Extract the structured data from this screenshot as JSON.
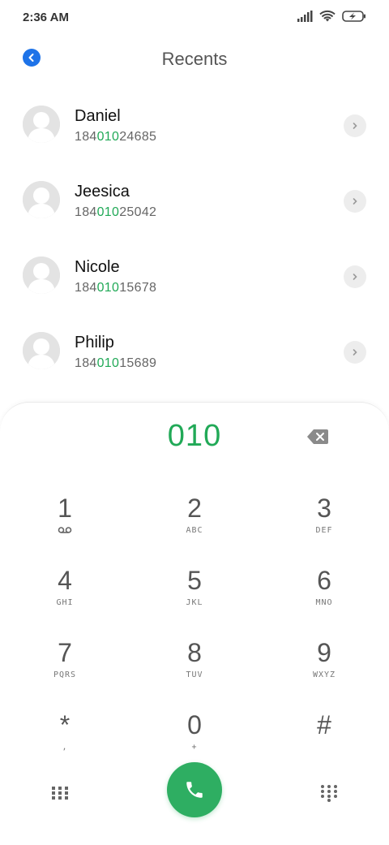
{
  "status_bar": {
    "time": "2:36 AM"
  },
  "header": {
    "title": "Recents"
  },
  "contacts": [
    {
      "name": "Daniel",
      "prefix": "184",
      "match": "010",
      "suffix": "24685"
    },
    {
      "name": "Jeesica",
      "prefix": "184",
      "match": "010",
      "suffix": "25042"
    },
    {
      "name": "Nicole",
      "prefix": "184",
      "match": "010",
      "suffix": "15678"
    },
    {
      "name": "Philip",
      "prefix": "184",
      "match": "010",
      "suffix": "15689"
    }
  ],
  "dialer": {
    "input": "010",
    "keys": [
      {
        "digit": "1",
        "letters": ""
      },
      {
        "digit": "2",
        "letters": "ABC"
      },
      {
        "digit": "3",
        "letters": "DEF"
      },
      {
        "digit": "4",
        "letters": "GHI"
      },
      {
        "digit": "5",
        "letters": "JKL"
      },
      {
        "digit": "6",
        "letters": "MNO"
      },
      {
        "digit": "7",
        "letters": "PQRS"
      },
      {
        "digit": "8",
        "letters": "TUV"
      },
      {
        "digit": "9",
        "letters": "WXYZ"
      },
      {
        "digit": "*",
        "letters": ","
      },
      {
        "digit": "0",
        "letters": "+"
      },
      {
        "digit": "#",
        "letters": ""
      }
    ]
  },
  "colors": {
    "accent_green": "#21a957",
    "call_button": "#2eae62",
    "back_button": "#1e73e8"
  },
  "icons": {
    "back": "back-arrow-icon",
    "chevron": "chevron-right-icon",
    "backspace": "backspace-icon",
    "voicemail": "voicemail-icon",
    "call": "phone-icon",
    "grid": "dialpad-grid-icon"
  }
}
